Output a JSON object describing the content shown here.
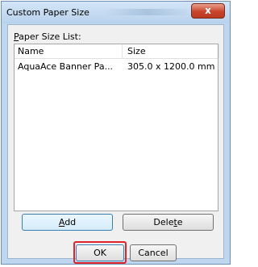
{
  "window": {
    "title": "Custom Paper Size",
    "close_glyph": "x"
  },
  "list": {
    "label_prefix": "P",
    "label_rest": "aper Size List:",
    "columns": [
      "Name",
      "Size"
    ],
    "rows": [
      {
        "name": "AquaAce Banner  Pa...",
        "size": "305.0 x 1200.0 mm"
      }
    ]
  },
  "buttons": {
    "add_prefix": "A",
    "add_rest": "dd",
    "delete_prefix": "Dele",
    "delete_underline": "t",
    "delete_rest": "e",
    "ok": "OK",
    "cancel": "Cancel"
  },
  "colors": {
    "highlight": "#e0242b",
    "close_button": "#c8452c"
  }
}
